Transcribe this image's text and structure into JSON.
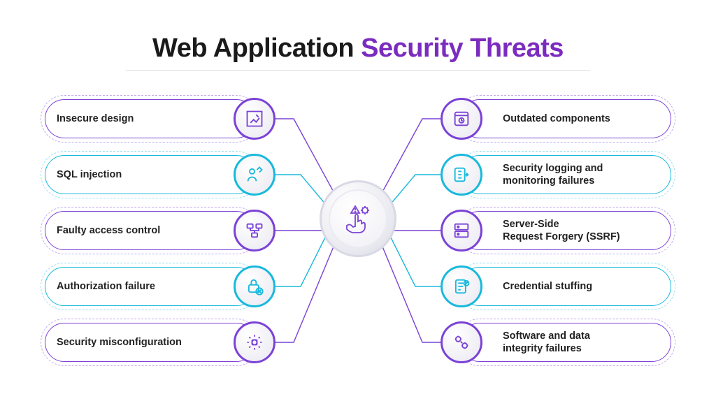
{
  "title": {
    "part1": "Web Application ",
    "part2": "Security Threats"
  },
  "hub": {
    "icon": "hand-warning-gear-icon"
  },
  "colors": {
    "purple": "#7b42d6",
    "cyan": "#18b9dc"
  },
  "threats": {
    "left": [
      {
        "label": "Insecure design",
        "color": "purple",
        "icon": "design-icon"
      },
      {
        "label": "SQL injection",
        "color": "cyan",
        "icon": "sql-injection-icon"
      },
      {
        "label": "Faulty access control",
        "color": "purple",
        "icon": "access-control-icon"
      },
      {
        "label": "Authorization failure",
        "color": "cyan",
        "icon": "lock-denied-icon"
      },
      {
        "label": "Security misconfiguration",
        "color": "purple",
        "icon": "misconfig-icon"
      }
    ],
    "right": [
      {
        "label": "Outdated components",
        "color": "purple",
        "icon": "outdated-icon"
      },
      {
        "label": "Security logging and\nmonitoring failures",
        "color": "cyan",
        "icon": "logging-icon"
      },
      {
        "label": "Server-Side\nRequest Forgery (SSRF)",
        "color": "purple",
        "icon": "server-icon"
      },
      {
        "label": "Credential stuffing",
        "color": "cyan",
        "icon": "credential-icon"
      },
      {
        "label": "Software and data\nintegrity failures",
        "color": "purple",
        "icon": "integrity-icon"
      }
    ]
  }
}
